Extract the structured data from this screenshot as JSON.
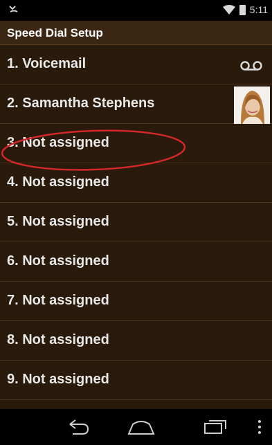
{
  "status": {
    "time": "5:11"
  },
  "header": {
    "title": "Speed Dial Setup"
  },
  "list": [
    {
      "label": "1. Voicemail",
      "icon": "voicemail-icon"
    },
    {
      "label": "2. Samantha Stephens"
    },
    {
      "label": "3. Not assigned"
    },
    {
      "label": "4. Not assigned"
    },
    {
      "label": "5. Not assigned"
    },
    {
      "label": "6. Not assigned"
    },
    {
      "label": "7. Not assigned"
    },
    {
      "label": "8. Not assigned"
    },
    {
      "label": "9. Not assigned"
    }
  ],
  "colors": {
    "background": "#2a1a0c",
    "highlight_ellipse": "#d22828"
  }
}
